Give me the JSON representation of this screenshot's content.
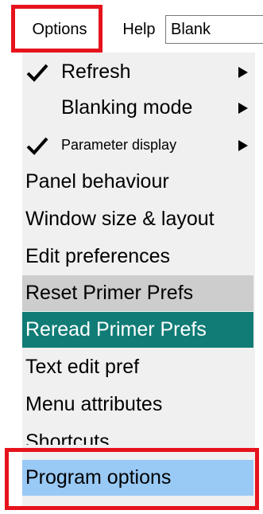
{
  "menubar": {
    "options_label": "Options",
    "help_label": "Help",
    "field_value": "Blank"
  },
  "dropdown": {
    "items": [
      {
        "label": "Refresh",
        "checked": true,
        "submenu": true,
        "state": "normal"
      },
      {
        "label": "Blanking mode",
        "checked": false,
        "submenu": true,
        "state": "normal"
      },
      {
        "label": "Parameter display",
        "checked": true,
        "submenu": true,
        "state": "normal"
      },
      {
        "label": "Panel behaviour",
        "checked": false,
        "submenu": false,
        "state": "normal"
      },
      {
        "label": "Window size & layout",
        "checked": false,
        "submenu": false,
        "state": "normal"
      },
      {
        "label": "Edit preferences",
        "checked": false,
        "submenu": false,
        "state": "normal"
      },
      {
        "label": "Reset Primer Prefs",
        "checked": false,
        "submenu": false,
        "state": "gray-highlight"
      },
      {
        "label": "Reread Primer Prefs",
        "checked": false,
        "submenu": false,
        "state": "teal-highlight"
      },
      {
        "label": "Text edit pref",
        "checked": false,
        "submenu": false,
        "state": "normal"
      },
      {
        "label": "Menu attributes",
        "checked": false,
        "submenu": false,
        "state": "normal"
      },
      {
        "label": "Shortcuts",
        "checked": false,
        "submenu": false,
        "state": "normal"
      },
      {
        "label": "Program options",
        "checked": false,
        "submenu": false,
        "state": "blue-highlight"
      }
    ]
  },
  "colors": {
    "annotation_red": "#e6131c",
    "menu_bg": "#f0f0f0",
    "gray_highlight": "#cdcdcd",
    "teal_highlight": "#117c76",
    "blue_highlight": "#99c9f5"
  }
}
